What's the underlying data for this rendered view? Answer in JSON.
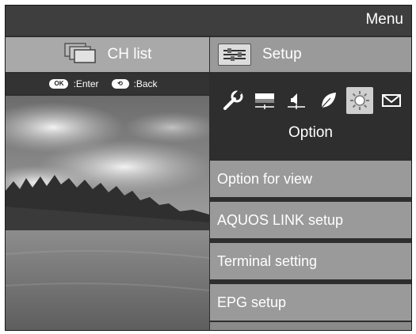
{
  "header": {
    "title": "Menu"
  },
  "tabs": {
    "ch_list": {
      "label": "CH list",
      "icon": "channel-list-icon"
    },
    "setup": {
      "label": "Setup",
      "icon": "setup-icon"
    }
  },
  "hints": {
    "enter_key": "OK",
    "enter_label": ":Enter",
    "back_key": "⟲",
    "back_label": ":Back"
  },
  "categories": [
    {
      "icon": "wrench-icon",
      "selected": false
    },
    {
      "icon": "picture-icon",
      "selected": false
    },
    {
      "icon": "speaker-icon",
      "selected": false
    },
    {
      "icon": "leaf-icon",
      "selected": false
    },
    {
      "icon": "option-gear-icon",
      "selected": true
    },
    {
      "icon": "envelope-icon",
      "selected": false
    }
  ],
  "section": {
    "title": "Option"
  },
  "menu_items": [
    {
      "label": "Option for view"
    },
    {
      "label": "AQUOS LINK setup"
    },
    {
      "label": "Terminal setting"
    },
    {
      "label": "EPG setup"
    }
  ],
  "colors": {
    "background": "#2e2e2e",
    "tab_bg": "#a9a9a9",
    "item_bg": "#9a9a9a",
    "selected_icon_bg": "#cfcfcf"
  }
}
